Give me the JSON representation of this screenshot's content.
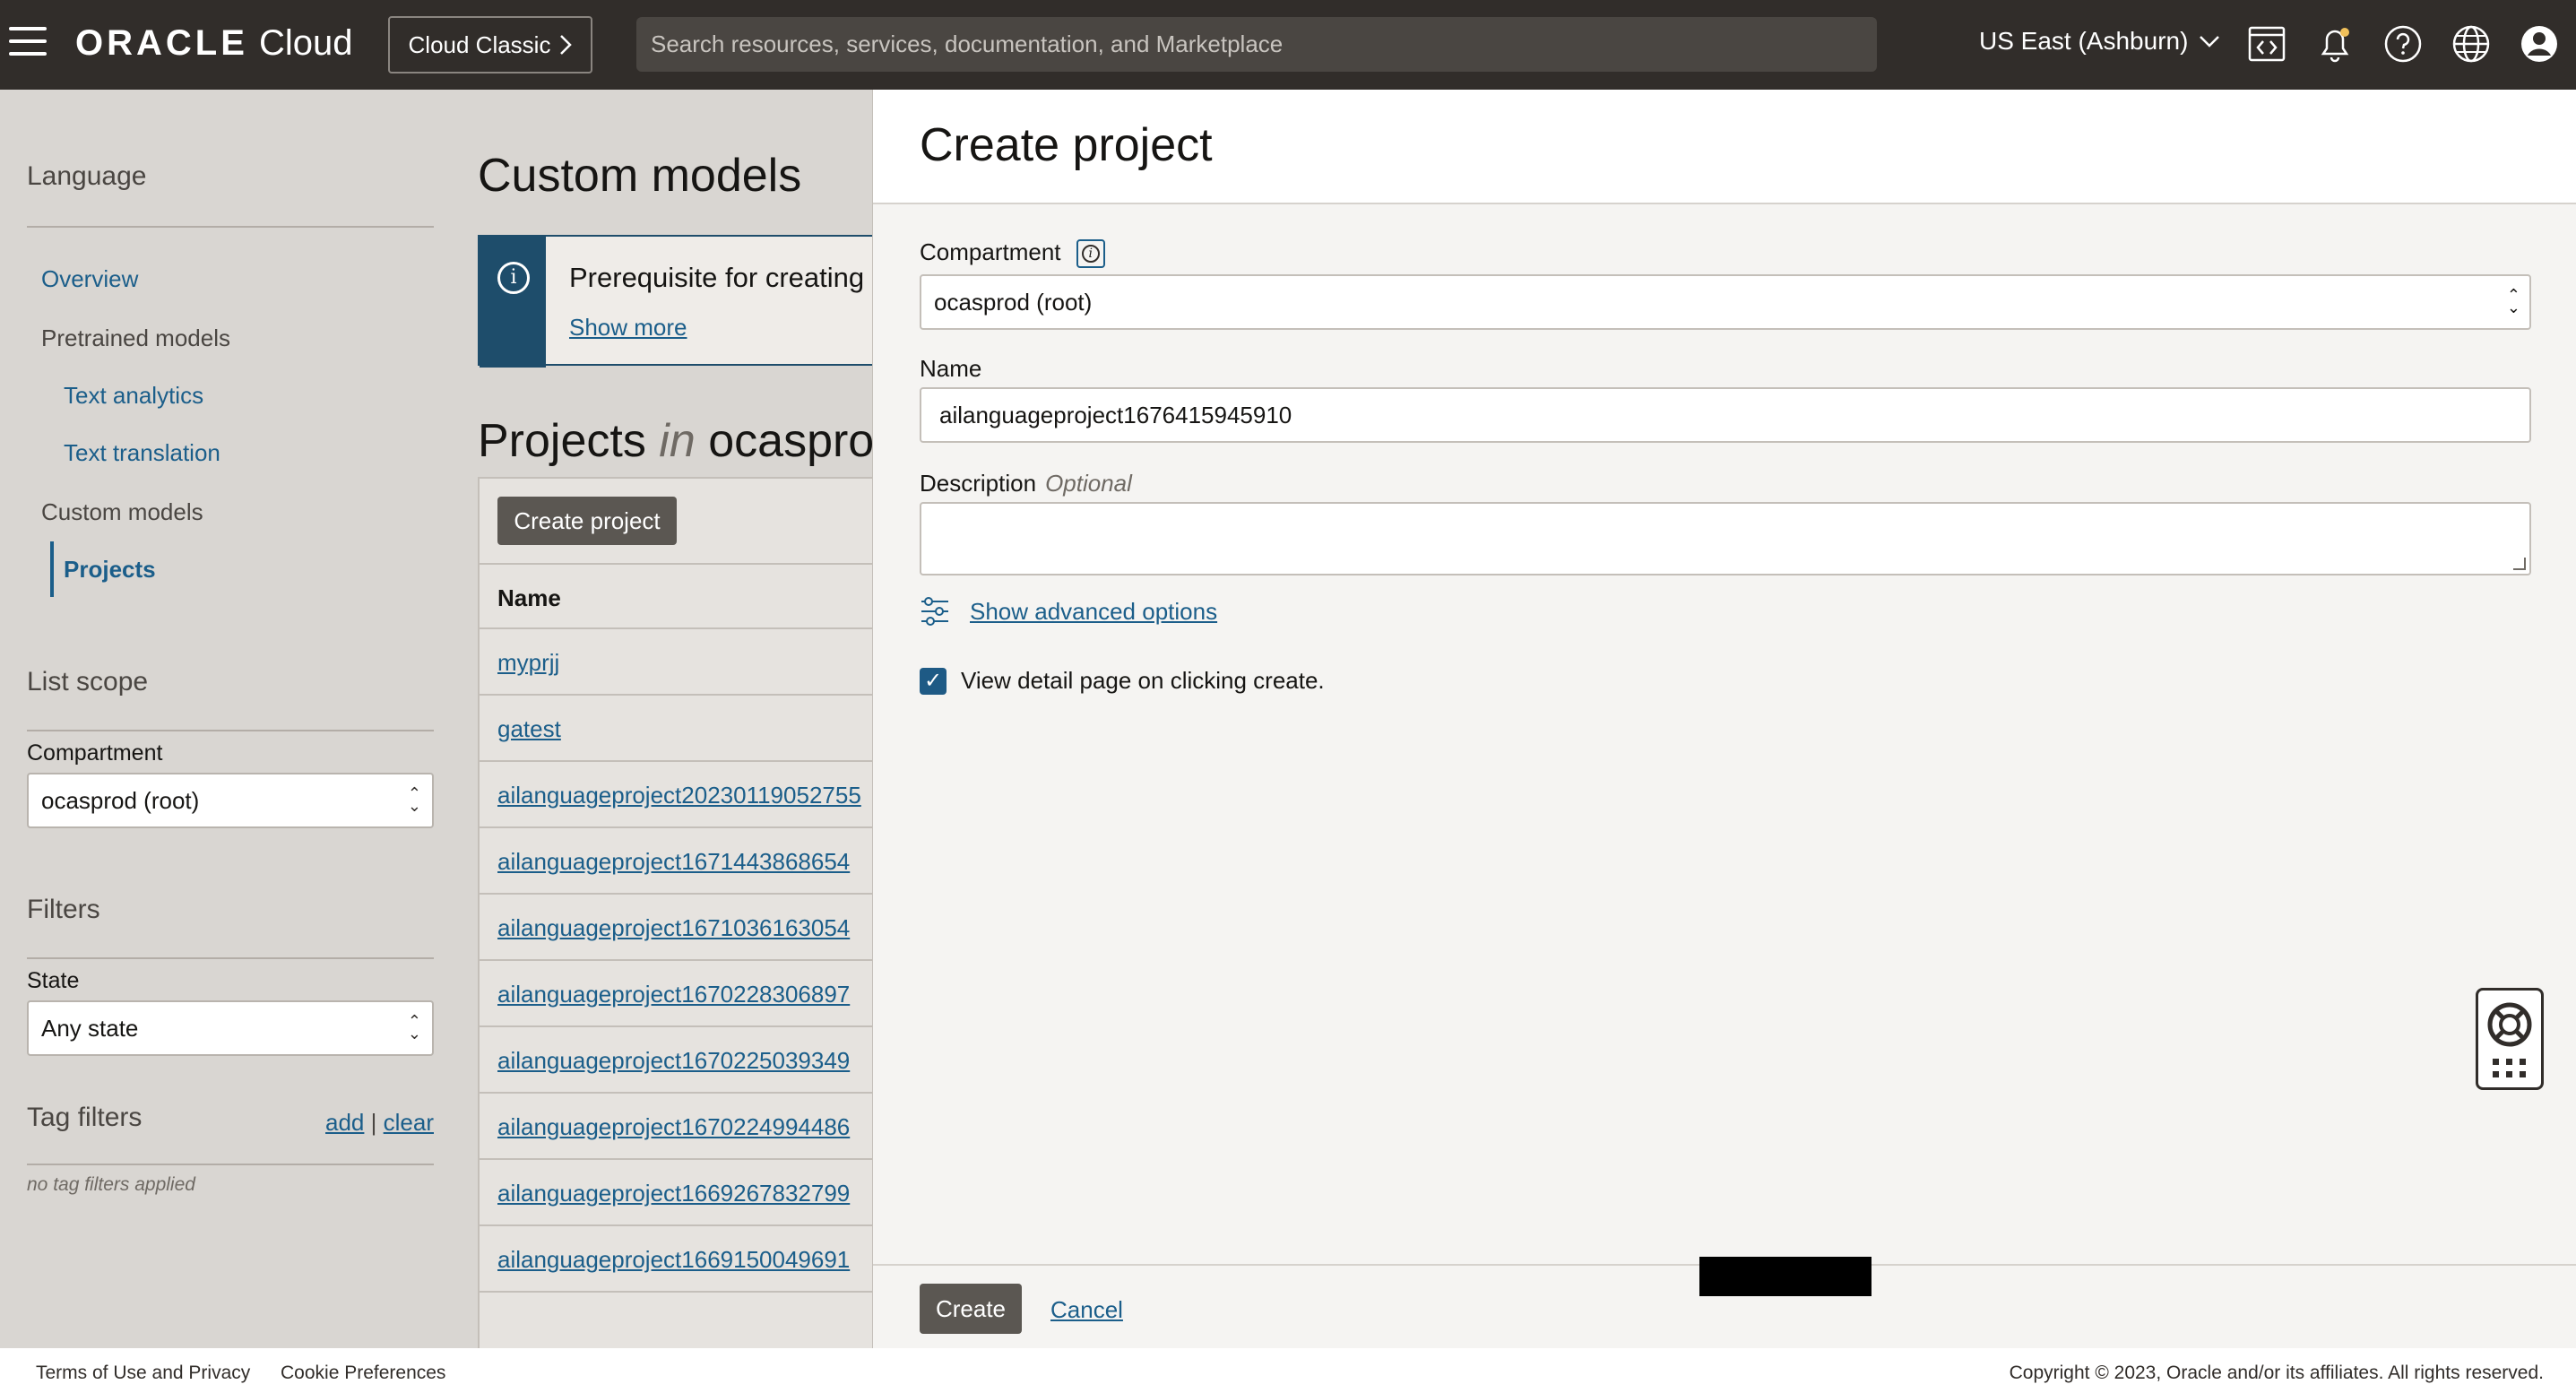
{
  "header": {
    "logo_brand": "ORACLE",
    "logo_product": "Cloud",
    "classic_label": "Cloud Classic",
    "search_placeholder": "Search resources, services, documentation, and Marketplace",
    "region": "US East (Ashburn)"
  },
  "sidebar": {
    "section_title": "Language",
    "nav": {
      "overview": "Overview",
      "pretrained": "Pretrained models",
      "text_analytics": "Text analytics",
      "text_translation": "Text translation",
      "custom_models": "Custom models",
      "projects": "Projects"
    },
    "list_scope": "List scope",
    "compartment_label": "Compartment",
    "compartment_value": "ocasprod (root)",
    "filters": "Filters",
    "state_label": "State",
    "state_value": "Any state",
    "tag_filters": "Tag filters",
    "tag_add": "add",
    "tag_sep": "|",
    "tag_clear": "clear",
    "no_tags": "no tag filters applied"
  },
  "main": {
    "title": "Custom models",
    "banner_text": "Prerequisite for creating custom models",
    "banner_link": "Show more",
    "projects_title_pre": "Projects",
    "projects_title_in": "in",
    "projects_title_post": "ocasprod (root)",
    "create_button": "Create project",
    "col_name": "Name",
    "rows": [
      "myprjj",
      "gatest",
      "ailanguageproject20230119052755",
      "ailanguageproject1671443868654",
      "ailanguageproject1671036163054",
      "ailanguageproject1670228306897",
      "ailanguageproject1670225039349",
      "ailanguageproject1670224994486",
      "ailanguageproject1669267832799",
      "ailanguageproject1669150049691"
    ]
  },
  "drawer": {
    "title": "Create project",
    "compartment_label": "Compartment",
    "compartment_value": "ocasprod (root)",
    "name_label": "Name",
    "name_value": "ailanguageproject1676415945910",
    "description_label": "Description",
    "description_optional": "Optional",
    "description_value": "",
    "advanced_link": "Show advanced options",
    "checkbox_label": "View detail page on clicking create.",
    "checkbox_checked": true,
    "create_button": "Create",
    "cancel_link": "Cancel"
  },
  "footer": {
    "terms": "Terms of Use and Privacy",
    "cookies": "Cookie Preferences",
    "copyright": "Copyright © 2023, Oracle and/or its affiliates. All rights reserved."
  },
  "colors": {
    "topbar": "#312d2a",
    "link": "#1b5e8a",
    "banner_accent": "#1e4d6b",
    "button": "#5b5752"
  },
  "icons": [
    "menu-icon",
    "chevron-right-icon",
    "chevron-down-icon",
    "code-editor-icon",
    "bell-icon",
    "help-icon",
    "globe-icon",
    "user-avatar-icon",
    "info-icon",
    "sliders-icon",
    "checkmark-icon",
    "lifebuoy-icon",
    "grid-icon"
  ]
}
